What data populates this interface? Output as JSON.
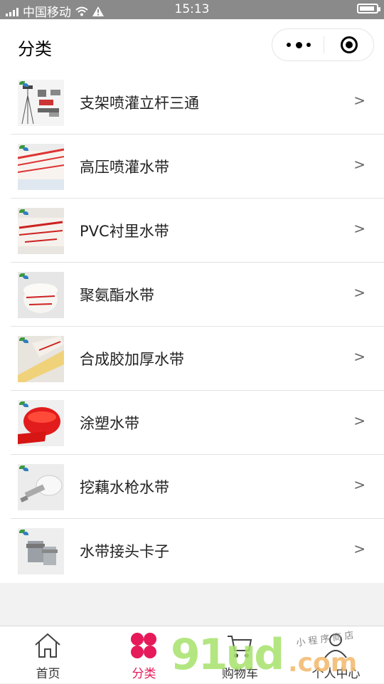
{
  "status_bar": {
    "carrier": "中国移动",
    "time": "15:13",
    "icons": [
      "signal-icon",
      "wifi-icon",
      "warning-icon",
      "battery-icon"
    ]
  },
  "header": {
    "title": "分类"
  },
  "categories": [
    {
      "label": "支架喷灌立杆三通",
      "chevron": ">"
    },
    {
      "label": "高压喷灌水带",
      "chevron": ">"
    },
    {
      "label": "PVC衬里水带",
      "chevron": ">"
    },
    {
      "label": "聚氨酯水带",
      "chevron": ">"
    },
    {
      "label": "合成胶加厚水带",
      "chevron": ">"
    },
    {
      "label": "涂塑水带",
      "chevron": ">"
    },
    {
      "label": "挖藕水枪水带",
      "chevron": ">"
    },
    {
      "label": "水带接头卡子",
      "chevron": ">"
    }
  ],
  "tabbar": {
    "tabs": [
      {
        "label": "首页",
        "icon": "home-icon"
      },
      {
        "label": "分类",
        "icon": "category-icon"
      },
      {
        "label": "购物车",
        "icon": "cart-icon"
      },
      {
        "label": "个人中心",
        "icon": "user-icon"
      }
    ],
    "active_color": "#e6195a"
  },
  "watermark": {
    "big": "91ud",
    "com": ".com",
    "small": "小 程 序 商 店"
  },
  "colors": {
    "status_bar": "#8a8a8a",
    "accent": "#e6195a",
    "background": "#f2f2f2"
  }
}
